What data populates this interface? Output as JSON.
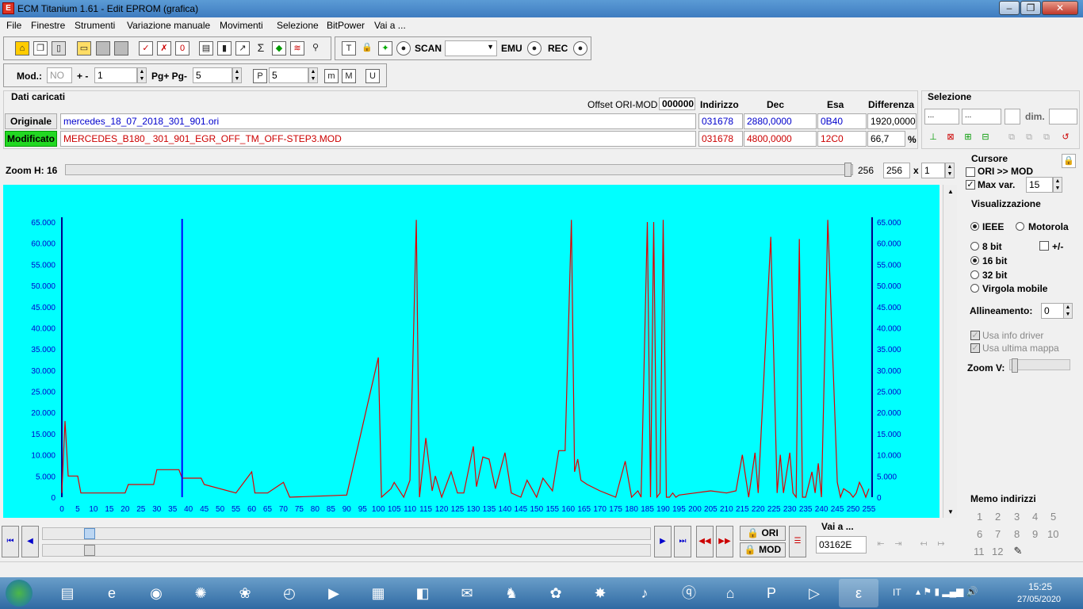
{
  "window": {
    "title": "ECM Titanium 1.61 - Edit EPROM (grafica)"
  },
  "menu": [
    "File",
    "Finestre",
    "Strumenti",
    "Variazione manuale",
    "Movimenti",
    "Selezione",
    "BitPower",
    "Vai a ..."
  ],
  "toolbar": {
    "scan": "SCAN",
    "emu": "EMU",
    "rec": "REC"
  },
  "toolbar2": {
    "mod_label": "Mod.:",
    "mod_value": "NO",
    "plusminus_label": "+ -",
    "plusminus_value": "1",
    "pg_label": "Pg+ Pg-",
    "pg_value": "5",
    "p_value": "5"
  },
  "dati": {
    "title": "Dati caricati",
    "offset_label": "Offset ORI-MOD",
    "offset_value": "000000",
    "headers": {
      "indirizzo": "Indirizzo",
      "dec": "Dec",
      "esa": "Esa",
      "diff": "Differenza"
    },
    "originale": {
      "label": "Originale",
      "file": "mercedes_18_07_2018_301_901.ori",
      "indirizzo": "031678",
      "dec": "2880,0000",
      "esa": "0B40",
      "diff": "1920,0000"
    },
    "modificato": {
      "label": "Modificato",
      "file": "MERCEDES_B180_ 301_901_EGR_OFF_TM_OFF-STEP3.MOD",
      "indirizzo": "031678",
      "dec": "4800,0000",
      "esa": "12C0",
      "diff": "66,7",
      "pct": "%"
    }
  },
  "selezione": {
    "title": "Selezione",
    "f1": "...",
    "f2": "...",
    "dim_label": "dim."
  },
  "zoom": {
    "label": "Zoom H: 16",
    "value1": "256",
    "value2": "256",
    "x": "x",
    "mult": "1"
  },
  "cursore": {
    "title": "Cursore",
    "ori_mod": "ORI >> MOD",
    "max_var": "Max var.",
    "max_var_value": "15"
  },
  "visual": {
    "title": "Visualizzazione",
    "ieee": "IEEE",
    "motorola": "Motorola",
    "b8": "8 bit",
    "pm": "+/-",
    "b16": "16 bit",
    "b32": "32 bit",
    "virgola": "Virgola mobile",
    "allineamento": "Allineamento:",
    "allineamento_value": "0",
    "usa_driver": "Usa info driver",
    "usa_mappa": "Usa ultima mappa",
    "zoomv": "Zoom V:"
  },
  "memo": {
    "title": "Memo indirizzi",
    "items": [
      "1",
      "2",
      "3",
      "4",
      "5",
      "6",
      "7",
      "8",
      "9",
      "10",
      "11",
      "12"
    ]
  },
  "bottom": {
    "ori": "ORI",
    "mod": "MOD",
    "vai_label": "Vai a ...",
    "vai_value": "03162E"
  },
  "taskbar": {
    "lang": "IT",
    "time": "15:25",
    "date": "27/05/2020"
  },
  "chart_data": {
    "type": "line",
    "ylim": [
      0,
      65000
    ],
    "xlim": [
      0,
      255
    ],
    "y_ticks": [
      "0",
      "5.000",
      "10.000",
      "15.000",
      "20.000",
      "25.000",
      "30.000",
      "35.000",
      "40.000",
      "45.000",
      "50.000",
      "55.000",
      "60.000",
      "65.000"
    ],
    "x_ticks": [
      "0",
      "5",
      "10",
      "15",
      "20",
      "25",
      "30",
      "35",
      "40",
      "45",
      "50",
      "55",
      "60",
      "65",
      "70",
      "75",
      "80",
      "85",
      "90",
      "95",
      "100",
      "105",
      "110",
      "115",
      "120",
      "125",
      "130",
      "135",
      "140",
      "145",
      "150",
      "155",
      "160",
      "165",
      "170",
      "175",
      "180",
      "185",
      "190",
      "195",
      "200",
      "205",
      "210",
      "215",
      "220",
      "225",
      "230",
      "235",
      "240",
      "245",
      "250",
      "255"
    ],
    "cursor_x": 38,
    "series": [
      {
        "color": "#e00000",
        "x": [
          0,
          1,
          2,
          5,
          6,
          10,
          20,
          21,
          29,
          30,
          37,
          38,
          44,
          45,
          55,
          60,
          61,
          65,
          70,
          72,
          90,
          100,
          101,
          104,
          105,
          108,
          110,
          112,
          113,
          115,
          117,
          118,
          120,
          123,
          125,
          127,
          130,
          131,
          133,
          135,
          137,
          140,
          142,
          145,
          147,
          150,
          152,
          155,
          157,
          159,
          161,
          162,
          163,
          164,
          166,
          170,
          175,
          178,
          180,
          182,
          183,
          185,
          186,
          187,
          188,
          189,
          190,
          191,
          192,
          193,
          194,
          195,
          200,
          205,
          210,
          213,
          215,
          217,
          219,
          220,
          224,
          226,
          227,
          228,
          230,
          231,
          232,
          233,
          234,
          235,
          237,
          238,
          239,
          240,
          242,
          245,
          246,
          247,
          249,
          250,
          251,
          252,
          253,
          254,
          255
        ],
        "y": [
          1000,
          18000,
          5000,
          5000,
          1000,
          1000,
          1000,
          3000,
          3000,
          6500,
          6500,
          4500,
          4500,
          3000,
          1000,
          6000,
          1000,
          1000,
          3500,
          0,
          500,
          33000,
          0,
          2000,
          3500,
          0,
          4000,
          65500,
          0,
          14000,
          1500,
          5000,
          0,
          6000,
          1000,
          1000,
          12000,
          2500,
          9500,
          9000,
          2000,
          10500,
          1000,
          0,
          4000,
          0,
          4500,
          1500,
          11000,
          11000,
          65500,
          6000,
          9000,
          4000,
          3000,
          1500,
          0,
          8500,
          0,
          1500,
          0,
          65000,
          0,
          65000,
          0,
          1000,
          65500,
          0,
          0,
          1000,
          0,
          500,
          1000,
          1500,
          1000,
          1500,
          10000,
          0,
          10500,
          1000,
          61500,
          1000,
          10000,
          1000,
          10500,
          1000,
          0,
          61000,
          0,
          0,
          6000,
          1000,
          8000,
          0,
          65500,
          3500,
          0,
          2000,
          1000,
          0,
          1000,
          3500,
          2000,
          0,
          2000
        ]
      }
    ]
  }
}
